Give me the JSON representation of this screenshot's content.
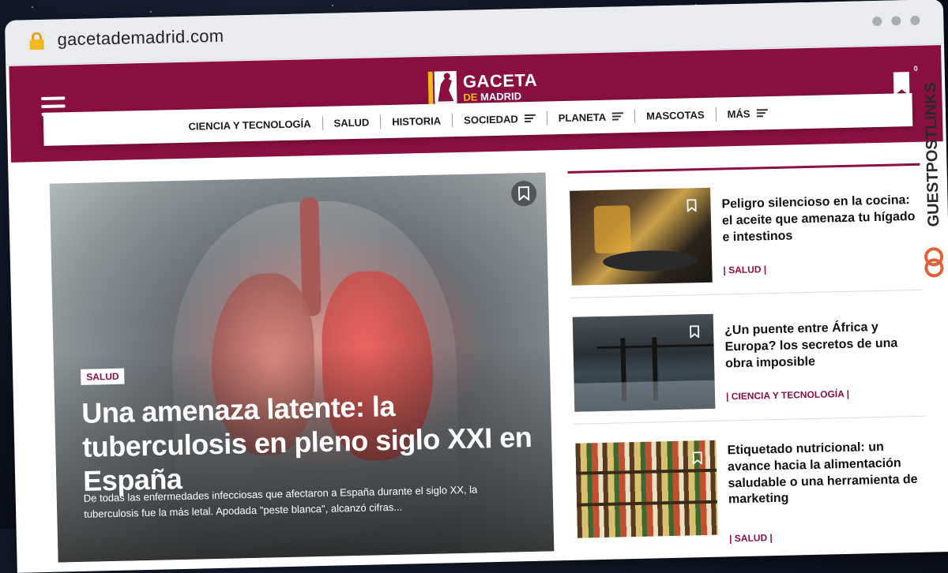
{
  "browser": {
    "url": "gacetademadrid.com"
  },
  "site": {
    "logo_line1": "GACETA",
    "logo_de": "DE",
    "logo_line2": "MADRID",
    "bookmark_count": "0"
  },
  "nav": {
    "items": [
      {
        "label": "Ciencia y Tecnología",
        "has_menu": false
      },
      {
        "label": "Salud",
        "has_menu": false
      },
      {
        "label": "Historia",
        "has_menu": false
      },
      {
        "label": "Sociedad",
        "has_menu": true
      },
      {
        "label": "Planeta",
        "has_menu": true
      },
      {
        "label": "Mascotas",
        "has_menu": false
      },
      {
        "label": "Más",
        "has_menu": true
      }
    ]
  },
  "hero": {
    "tag": "SALUD",
    "title": "Una amenaza latente: la tuberculosis en pleno siglo XXI en España",
    "description": "De todas las enfermedades infecciosas que afectaron a España durante el siglo XX, la tuberculosis fue la más letal. Apodada \"peste blanca\", alcanzó cifras..."
  },
  "side_articles": [
    {
      "title": "Peligro silencioso en la cocina: el aceite que amenaza tu hígado e intestinos",
      "tag": "| SALUD |"
    },
    {
      "title": "¿Un puente entre África y Europa? los secretos de una obra imposible",
      "tag": "| CIENCIA Y TECNOLOGÍA |"
    },
    {
      "title": "Etiquetado nutricional: un avance hacia la alimentación saludable o una herramienta de marketing",
      "tag": "| SALUD |"
    }
  ],
  "watermark": {
    "text": "GUESTPOSTLINKS"
  },
  "colors": {
    "brand": "#8a1042",
    "logo_accent": "#f2b820",
    "url_bar": "#e9ebef"
  },
  "icons": {
    "lock": "lock-icon",
    "menu": "hamburger-menu-icon",
    "bookmark": "bookmark-icon",
    "submenu": "lines-menu-icon"
  }
}
